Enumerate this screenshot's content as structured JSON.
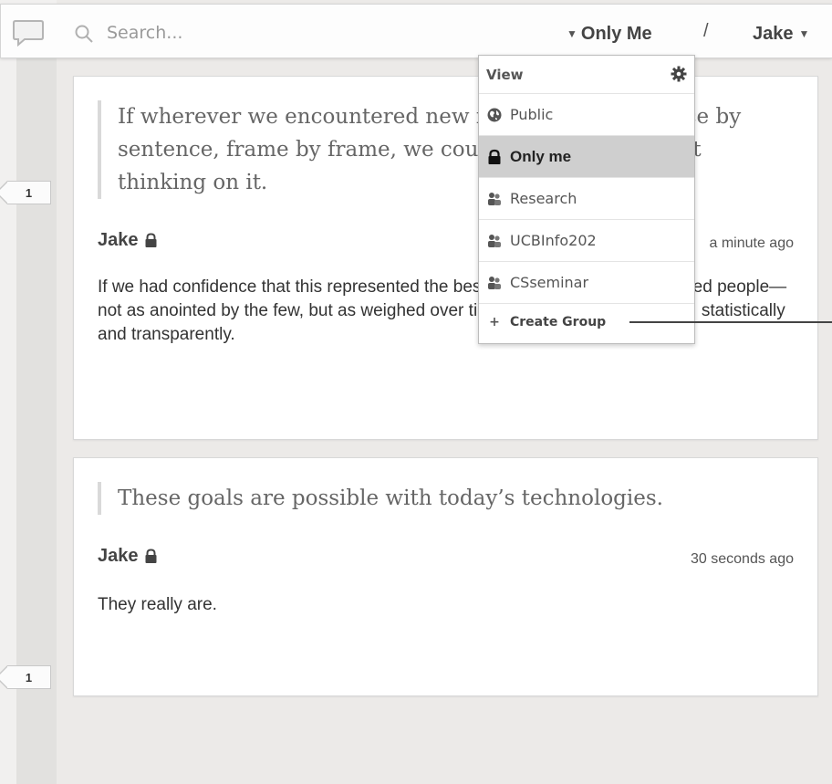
{
  "search": {
    "placeholder": "Search..."
  },
  "topbar": {
    "scope_label": "Only Me",
    "separator": "/",
    "user_label": "Jake"
  },
  "rail": {
    "counts": [
      "1",
      "1"
    ]
  },
  "annotations": [
    {
      "quote": "If wherever we encountered new information, sentence by sentence, frame by frame, we could easily see the best thinking on it.",
      "author": "Jake",
      "timestamp": "a minute ago",
      "body": "If we had confidence that this represented the best wisdom of the most informed people—not as anointed by the few, but as weighed over time by our peers, objectively, statistically and transparently."
    },
    {
      "quote": "These goals are possible with today’s technologies.",
      "author": "Jake",
      "timestamp": "30 seconds ago",
      "body": "They really are."
    }
  ],
  "menu": {
    "title": "View",
    "items": [
      {
        "label": "Public",
        "icon": "globe-icon",
        "selected": false
      },
      {
        "label": "Only me",
        "icon": "lock-icon",
        "selected": true
      },
      {
        "label": "Research",
        "icon": "group-icon",
        "selected": false
      },
      {
        "label": "UCBInfo202",
        "icon": "group-icon",
        "selected": false
      },
      {
        "label": "CSseminar",
        "icon": "group-icon",
        "selected": false
      }
    ],
    "create_label": "Create Group"
  }
}
